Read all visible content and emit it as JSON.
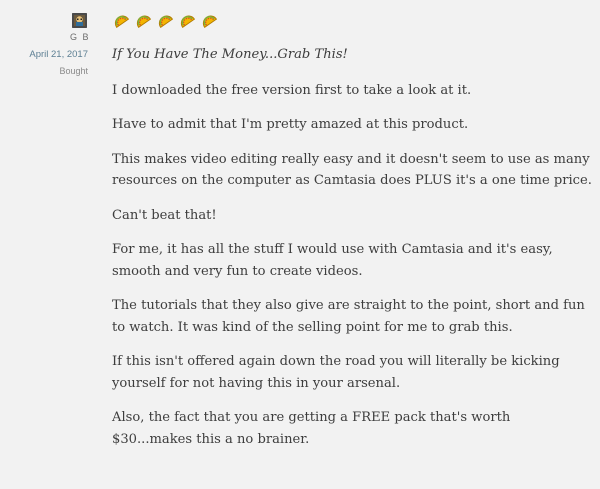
{
  "reviewer": {
    "name": "G B",
    "date": "April 21, 2017",
    "status": "Bought"
  },
  "rating": {
    "value": 5,
    "max": 5,
    "icon": "taco-icon",
    "color": "#f4b400"
  },
  "review": {
    "title": "If You Have The Money...Grab This!",
    "paragraphs": [
      "I downloaded the free version first to take a look at it.",
      "Have to admit that I'm pretty amazed at this product.",
      "This makes video editing really easy and it doesn't seem to use as many resources on the computer as Camtasia does PLUS it's a one time price.",
      "Can't beat that!",
      "For me, it has all the stuff I would use with Camtasia and it's easy, smooth and very fun to create videos.",
      "The tutorials that they also give are straight to the point, short and fun to watch. It was kind of the selling point for me to grab this.",
      "If this isn't offered again down the road you will literally be kicking yourself for not having this in your arsenal.",
      "Also, the fact that you are getting a FREE pack that's worth $30...makes this a no brainer."
    ]
  }
}
